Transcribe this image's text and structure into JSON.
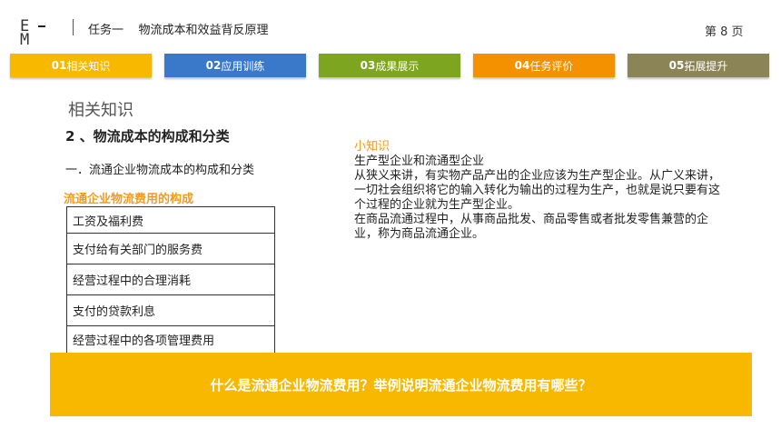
{
  "header": {
    "logo_text": "E M",
    "title": "任务一    物流成本和效益背反原理",
    "page_label": "第 8 页"
  },
  "tabs": [
    {
      "num": "01",
      "label": "相关知识",
      "color": "#f9b800"
    },
    {
      "num": "02",
      "label": "应用训练",
      "color": "#3a78c9"
    },
    {
      "num": "03",
      "label": "成果展示",
      "color": "#7ea51f"
    },
    {
      "num": "04",
      "label": "任务评价",
      "color": "#f39100"
    },
    {
      "num": "05",
      "label": "拓展提升",
      "color": "#8b8457"
    }
  ],
  "main": {
    "section_label": "相关知识",
    "sub_heading": "2 、物流成本的构成和分类",
    "bullet": "一．流通企业物流成本的构成和分类",
    "cost_heading": "流通企业物流费用的构成",
    "cost_items": [
      "工资及福利费",
      "支付给有关部门的服务费",
      "经营过程中的合理消耗",
      "支付的贷款利息",
      "经营过程中的各项管理费用"
    ]
  },
  "knowledge": {
    "title": "小知识",
    "lines": [
      "生产型企业和流通型企业",
      "从狭义来讲，有实物产品产出的企业应该为生产型企业。从广义来讲，一切社会组织将它的输入转化为输出的过程为生产，也就是说只要有这个过程的企业就为生产型企业。",
      "在商品流通过程中，从事商品批发、商品零售或者批发零售兼营的企业，称为商品流通企业。"
    ]
  },
  "banner": {
    "question": "什么是流通企业物流费用？举例说明流通企业物流费用有哪些？",
    "color": "#f9b800"
  }
}
